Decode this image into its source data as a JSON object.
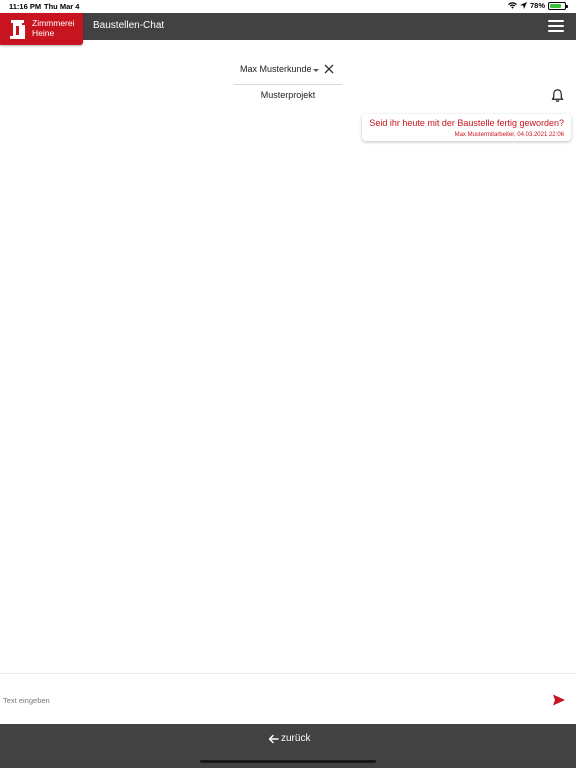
{
  "status": {
    "time": "11:16 PM",
    "date": "Thu Mar 4",
    "battery_text": "78%",
    "battery_level": 0.78,
    "battery_color": "#3ac13a"
  },
  "header": {
    "brand_line1": "Zimmmerei",
    "brand_line2": "Heine",
    "title": "Baustellen-Chat",
    "brand_color": "#c8141e",
    "bar_color": "#424242"
  },
  "filter": {
    "customer": "Max Musterkunde",
    "project": "Musterprojekt"
  },
  "messages": [
    {
      "text": "Seid ihr heute mit der Baustelle fertig geworden?",
      "meta": "Max Mustermitarbeiter, 04.03.2021 22:06"
    }
  ],
  "composer": {
    "placeholder": "Text eingeben",
    "value": ""
  },
  "footer": {
    "back_label": "zurück"
  }
}
